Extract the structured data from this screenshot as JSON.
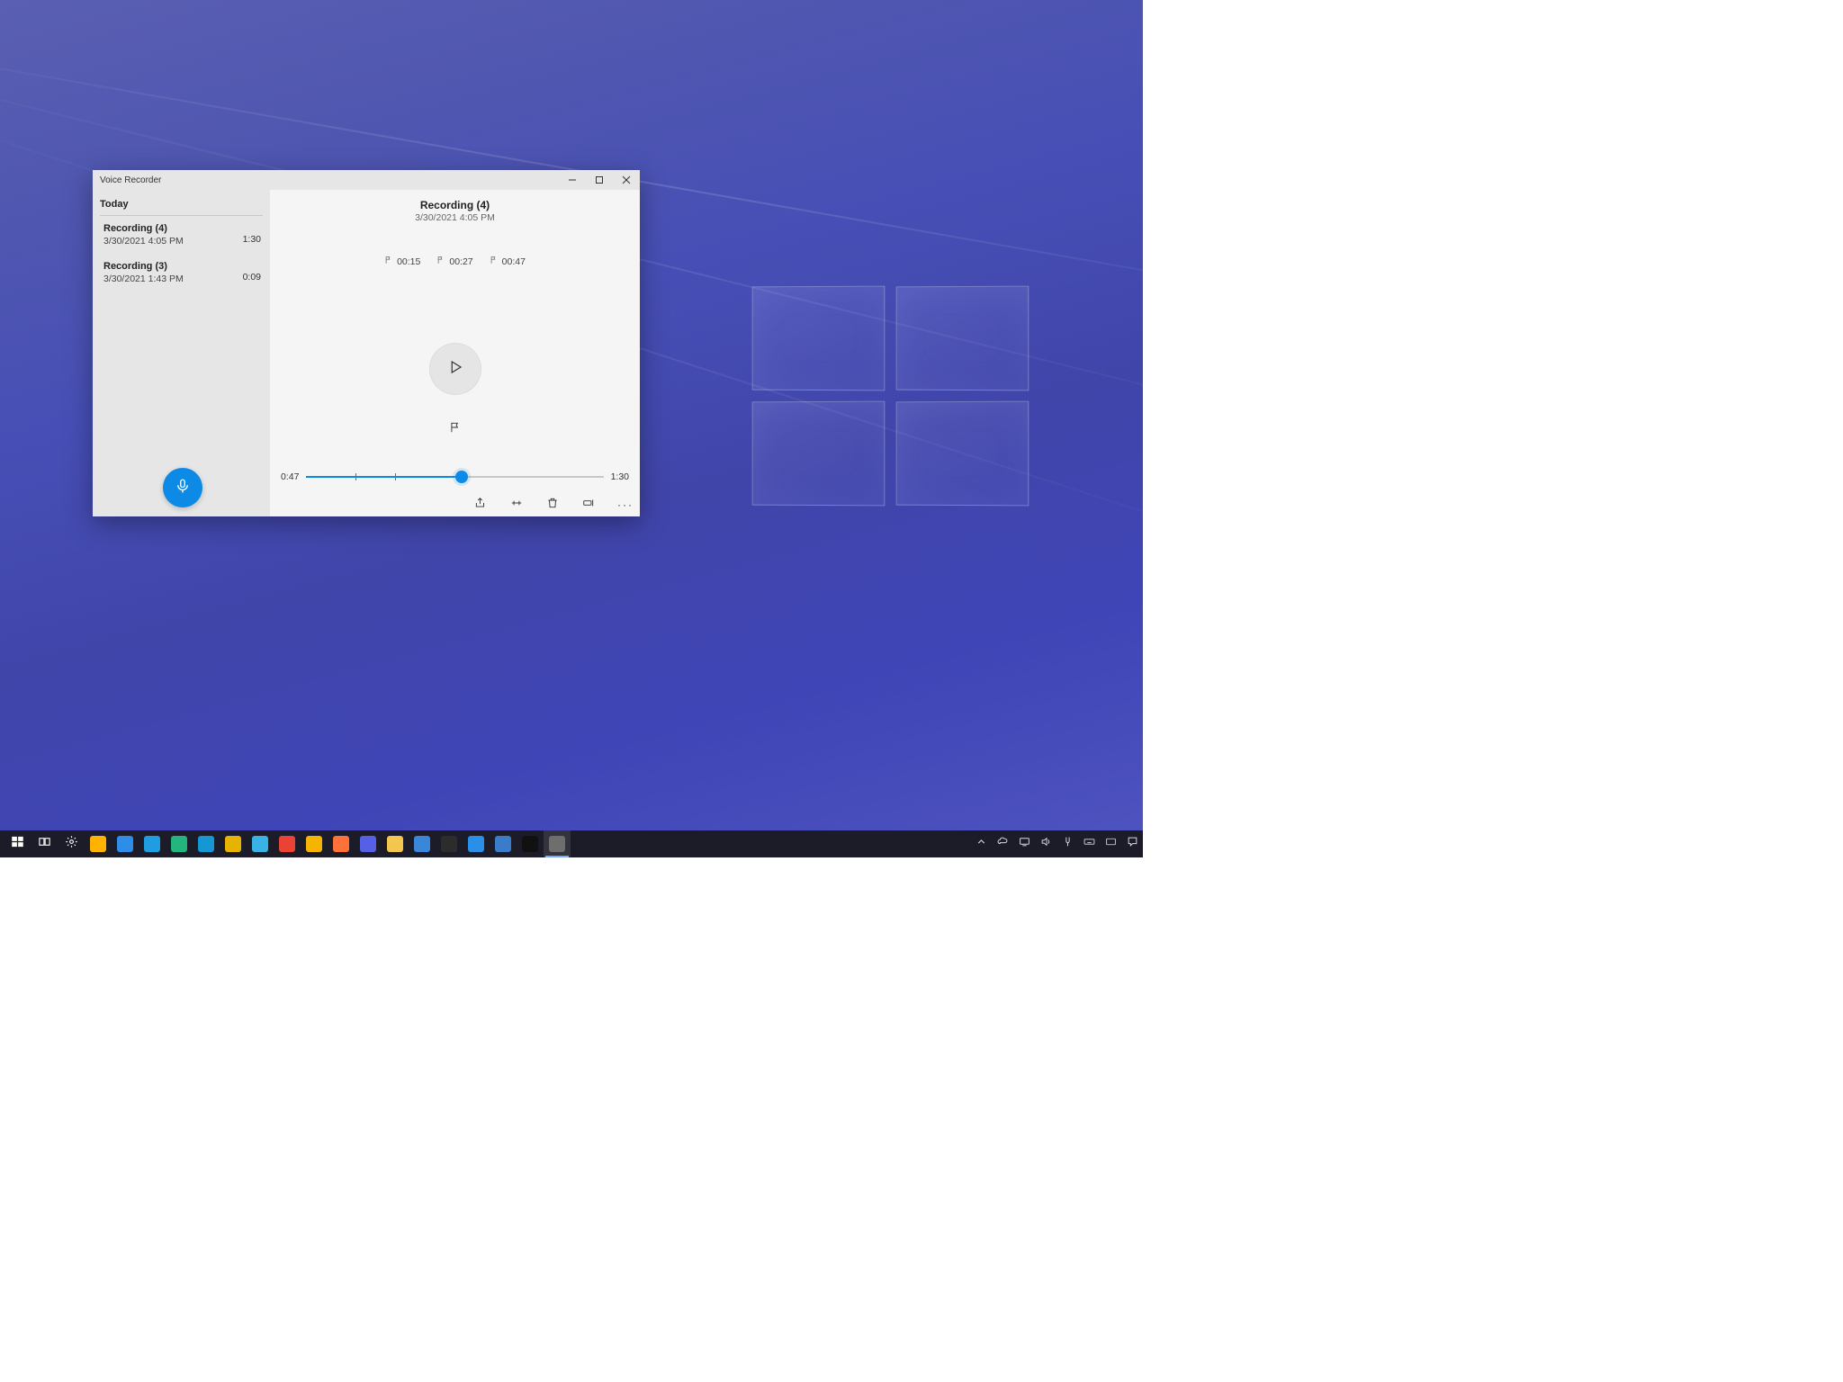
{
  "window": {
    "title": "Voice Recorder"
  },
  "sidebar": {
    "section": "Today",
    "recordings": [
      {
        "title": "Recording (4)",
        "subtitle": "3/30/2021 4:05 PM",
        "duration": "1:30",
        "selected": true
      },
      {
        "title": "Recording (3)",
        "subtitle": "3/30/2021 1:43 PM",
        "duration": "0:09",
        "selected": false
      }
    ]
  },
  "detail": {
    "title": "Recording (4)",
    "datetime": "3/30/2021 4:05 PM",
    "markers": [
      "00:15",
      "00:27",
      "00:47"
    ],
    "position": "0:47",
    "total": "1:30",
    "position_secs": 47,
    "total_secs": 90
  },
  "taskbar": {
    "items": [
      {
        "name": "start",
        "color": "#fff"
      },
      {
        "name": "task-view",
        "color": "#fff"
      },
      {
        "name": "settings",
        "color": "#fff"
      },
      {
        "name": "store",
        "color": "#ffb300"
      },
      {
        "name": "phone",
        "color": "#2e8de6"
      },
      {
        "name": "edge",
        "color": "#1e9de0"
      },
      {
        "name": "edge-dev",
        "color": "#24b47e"
      },
      {
        "name": "edge-beta",
        "color": "#1597d4"
      },
      {
        "name": "edge-canary",
        "color": "#e6b400"
      },
      {
        "name": "edge-classic",
        "color": "#39b3e6"
      },
      {
        "name": "chrome",
        "color": "#ea4335"
      },
      {
        "name": "chrome-canary",
        "color": "#f5b400"
      },
      {
        "name": "firefox",
        "color": "#ff7139"
      },
      {
        "name": "firefox-dev",
        "color": "#5560e6"
      },
      {
        "name": "file-explorer",
        "color": "#f3c74f"
      },
      {
        "name": "mail",
        "color": "#3a86d8"
      },
      {
        "name": "terminal",
        "color": "#2c2c2c"
      },
      {
        "name": "onedrive",
        "color": "#2a8fe6"
      },
      {
        "name": "photos",
        "color": "#3a7cc9"
      },
      {
        "name": "cmd",
        "color": "#111"
      },
      {
        "name": "voice-recorder",
        "color": "#6e6e6e",
        "active": true
      }
    ],
    "tray": [
      "chevron-up",
      "onedrive",
      "cast",
      "volume",
      "power",
      "keyboard",
      "language",
      "action-center"
    ]
  }
}
